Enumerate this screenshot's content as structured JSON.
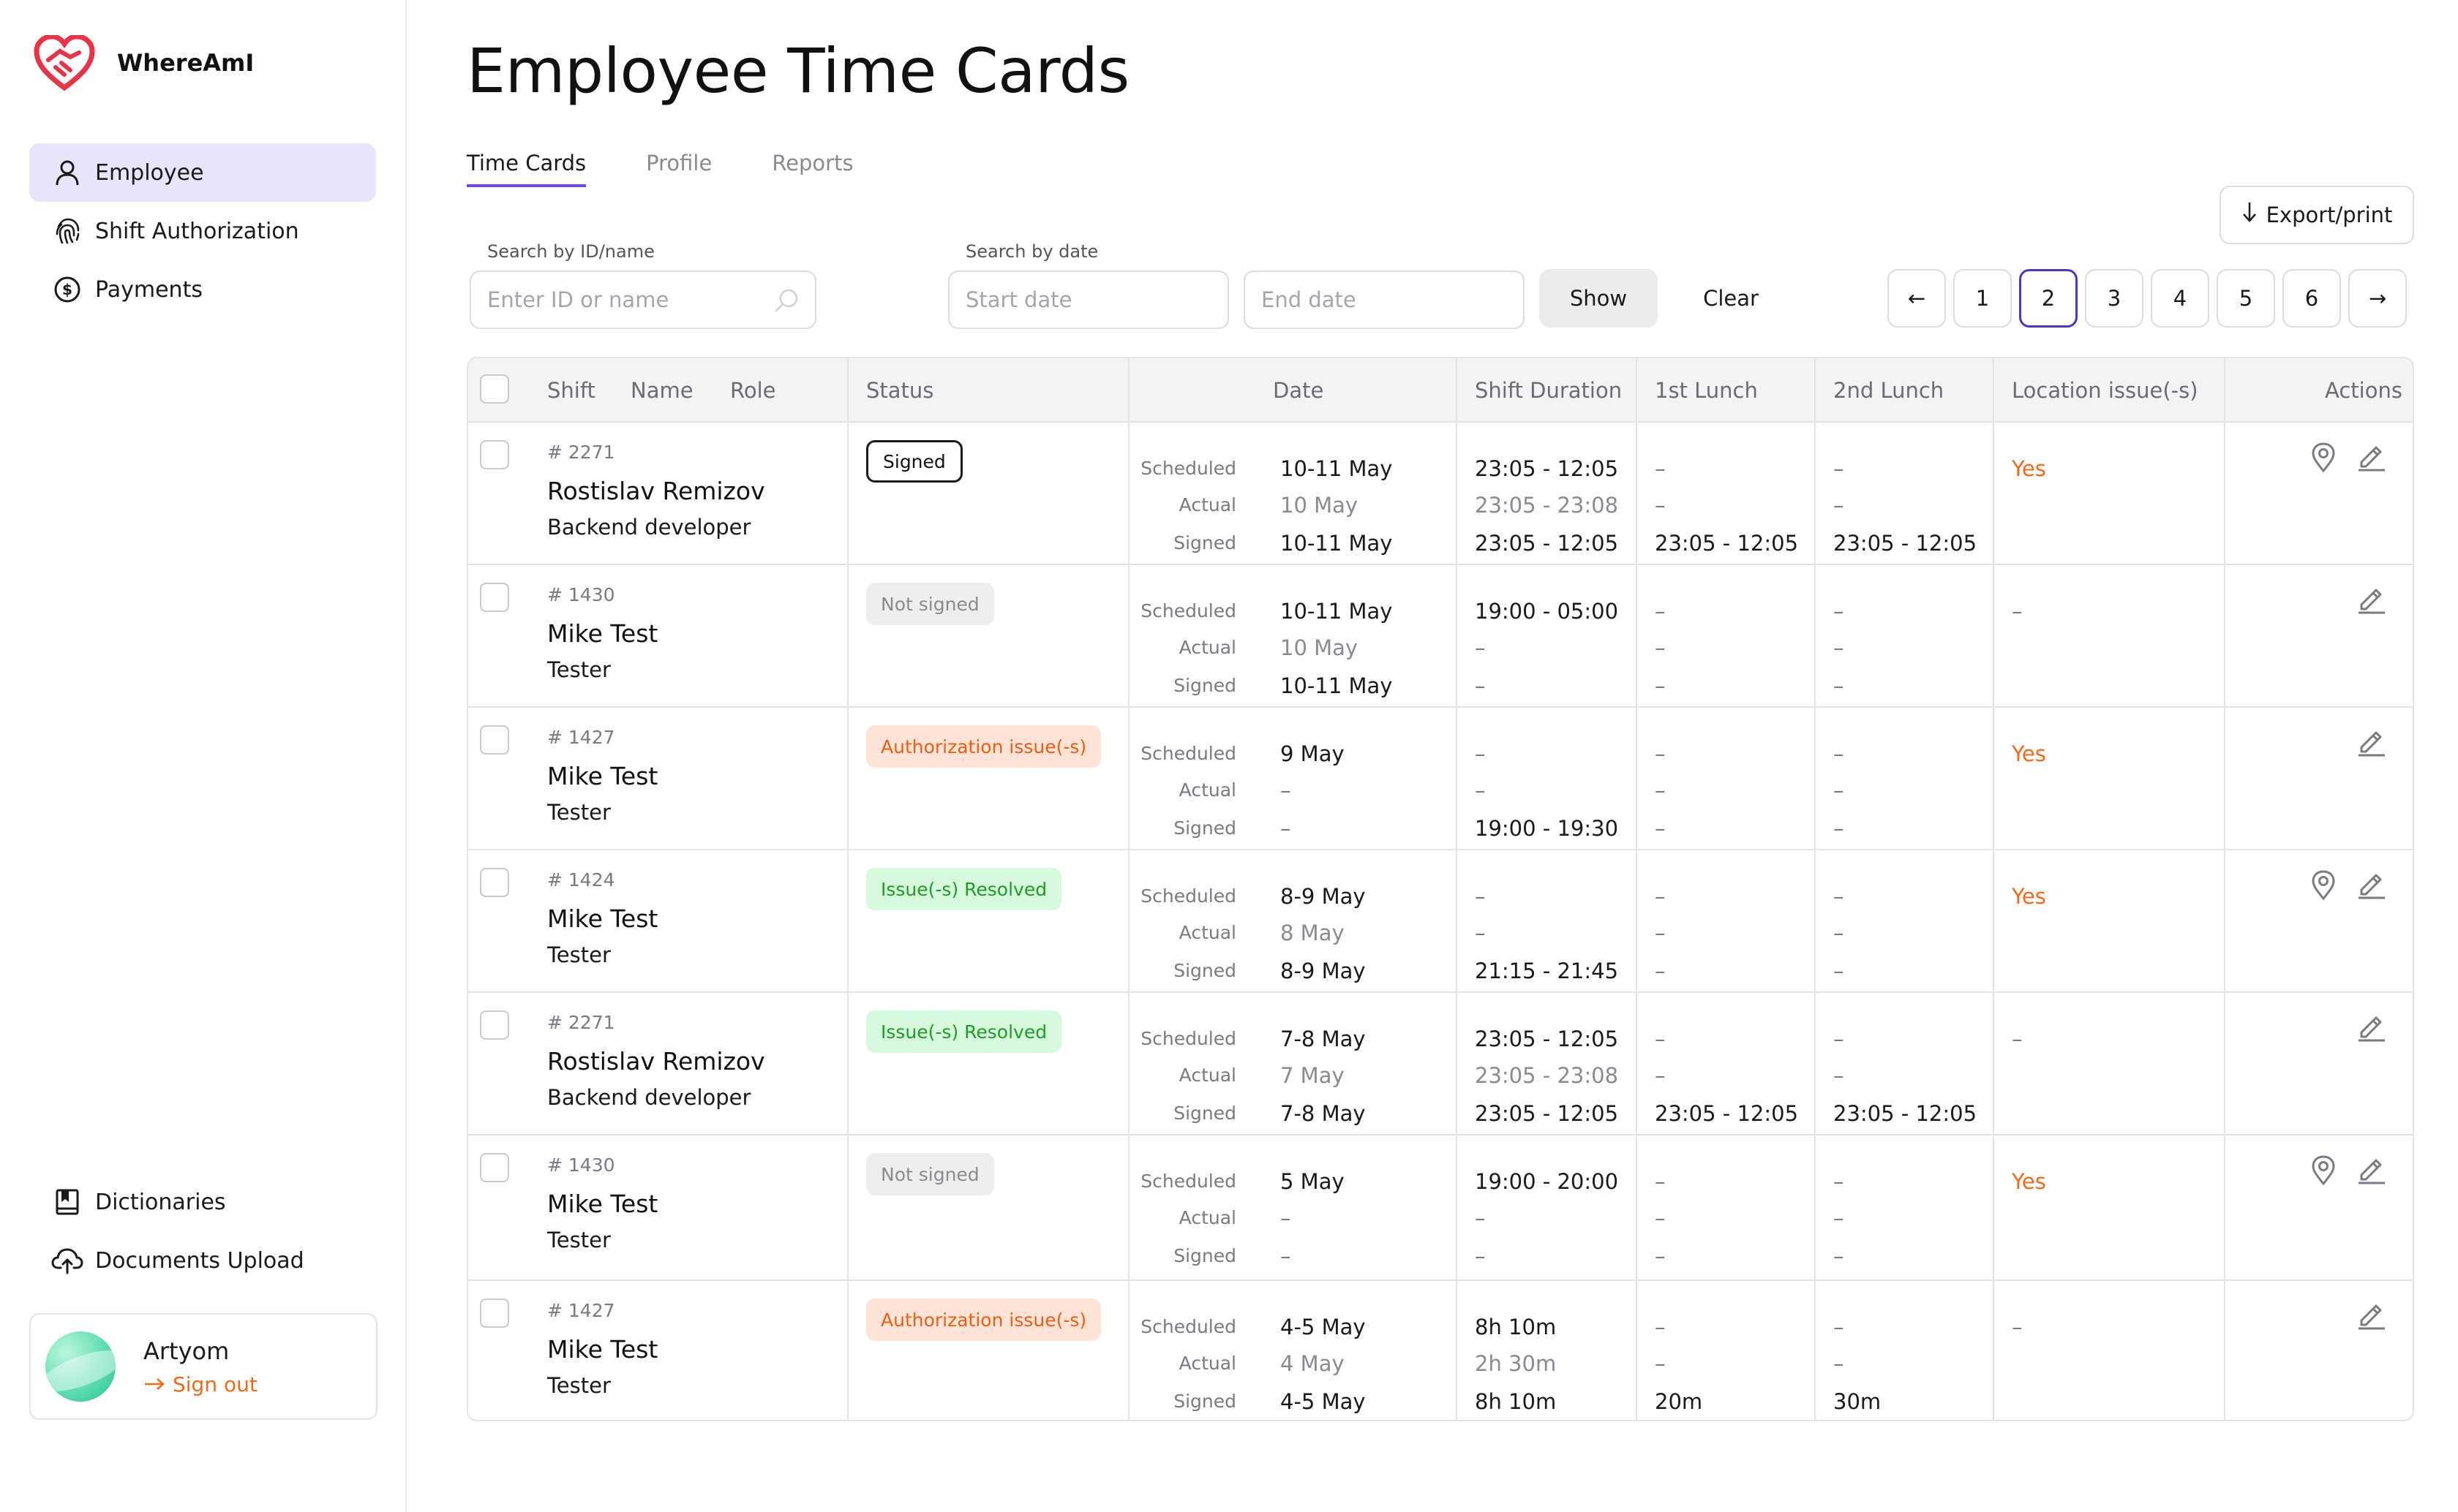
{
  "app": {
    "name": "WhereAmI"
  },
  "sidebar": {
    "items": [
      {
        "label": "Employee",
        "icon": "user-icon",
        "active": true
      },
      {
        "label": "Shift Authorization",
        "icon": "fingerprint-icon"
      },
      {
        "label": "Payments",
        "icon": "dollar-circle-icon"
      }
    ],
    "bottom_items": [
      {
        "label": "Dictionaries",
        "icon": "book-icon"
      },
      {
        "label": "Documents Upload",
        "icon": "cloud-upload-icon"
      }
    ],
    "user": {
      "name": "Artyom",
      "sign_out": "Sign out"
    }
  },
  "page": {
    "title": "Employee Time Cards"
  },
  "tabs": [
    {
      "label": "Time Cards",
      "active": true
    },
    {
      "label": "Profile"
    },
    {
      "label": "Reports"
    }
  ],
  "toolbar": {
    "export_label": "Export/print",
    "search_id_label": "Search by ID/name",
    "search_id_placeholder": "Enter ID or name",
    "search_date_label": "Search by date",
    "start_date_placeholder": "Start date",
    "end_date_placeholder": "End date",
    "show_label": "Show",
    "clear_label": "Clear"
  },
  "pagination": {
    "pages": [
      "1",
      "2",
      "3",
      "4",
      "5",
      "6"
    ],
    "current": "2",
    "prev": "←",
    "next": "→"
  },
  "table": {
    "headers": {
      "shift": "Shift",
      "name": "Name",
      "role": "Role",
      "status": "Status",
      "date": "Date",
      "duration": "Shift Duration",
      "lunch1": "1st Lunch",
      "lunch2": "2nd Lunch",
      "location": "Location issue(-s)",
      "actions": "Actions"
    },
    "date_labels": {
      "scheduled": "Scheduled",
      "actual": "Actual",
      "signed": "Signed"
    },
    "rows": [
      {
        "shift": "# 2271",
        "name": "Rostislav Remizov",
        "role": "Backend developer",
        "status": "Signed",
        "status_type": "signed",
        "date": [
          "10-11 May",
          "10 May",
          "10-11 May"
        ],
        "duration": [
          "23:05 - 12:05",
          "23:05 - 23:08",
          "23:05 - 12:05"
        ],
        "lunch1": [
          "–",
          "–",
          "23:05 - 12:05"
        ],
        "lunch2": [
          "–",
          "–",
          "23:05 - 12:05"
        ],
        "location": "Yes"
      },
      {
        "shift": "# 1430",
        "name": "Mike Test",
        "role": "Tester",
        "status": "Not signed",
        "status_type": "not-signed",
        "date": [
          "10-11 May",
          "10 May",
          "10-11 May"
        ],
        "duration": [
          "19:00 - 05:00",
          "–",
          "–"
        ],
        "lunch1": [
          "–",
          "–",
          "–"
        ],
        "lunch2": [
          "–",
          "–",
          "–"
        ],
        "location": "–"
      },
      {
        "shift": "# 1427",
        "name": "Mike Test",
        "role": "Tester",
        "status": "Authorization issue(-s)",
        "status_type": "auth",
        "date": [
          "9 May",
          "–",
          "–"
        ],
        "duration": [
          "–",
          "–",
          "19:00 - 19:30"
        ],
        "lunch1": [
          "–",
          "–",
          "–"
        ],
        "lunch2": [
          "–",
          "–",
          "–"
        ],
        "location": "Yes"
      },
      {
        "shift": "# 1424",
        "name": "Mike Test",
        "role": "Tester",
        "status": "Issue(-s) Resolved",
        "status_type": "resolved",
        "date": [
          "8-9 May",
          "8 May",
          "8-9 May"
        ],
        "duration": [
          "–",
          "–",
          "21:15 - 21:45"
        ],
        "lunch1": [
          "–",
          "–",
          "–"
        ],
        "lunch2": [
          "–",
          "–",
          "–"
        ],
        "location": "Yes"
      },
      {
        "shift": "# 2271",
        "name": "Rostislav Remizov",
        "role": "Backend developer",
        "status": "Issue(-s) Resolved",
        "status_type": "resolved",
        "date": [
          "7-8 May",
          "7 May",
          "7-8 May"
        ],
        "duration": [
          "23:05 - 12:05",
          "23:05 - 23:08",
          "23:05 - 12:05"
        ],
        "lunch1": [
          "–",
          "–",
          "23:05 - 12:05"
        ],
        "lunch2": [
          "–",
          "–",
          "23:05 - 12:05"
        ],
        "location": "–"
      },
      {
        "shift": "# 1430",
        "name": "Mike Test",
        "role": "Tester",
        "status": "Not signed",
        "status_type": "not-signed",
        "date": [
          "5 May",
          "–",
          "–"
        ],
        "duration": [
          "19:00 - 20:00",
          "–",
          "–"
        ],
        "lunch1": [
          "–",
          "–",
          "–"
        ],
        "lunch2": [
          "–",
          "–",
          "–"
        ],
        "location": "Yes"
      },
      {
        "shift": "# 1427",
        "name": "Mike Test",
        "role": "Tester",
        "status": "Authorization issue(-s)",
        "status_type": "auth",
        "date": [
          "4-5 May",
          "4 May",
          "4-5 May"
        ],
        "duration": [
          "8h 10m",
          "2h 30m",
          "8h 10m"
        ],
        "lunch1": [
          "–",
          "–",
          "20m"
        ],
        "lunch2": [
          "–",
          "–",
          "30m"
        ],
        "location": "–"
      }
    ]
  },
  "colors": {
    "accent": "#6a4ce0",
    "orange": "#f26a1b",
    "green": "#1e9c2a",
    "brand": "#e8344a"
  }
}
